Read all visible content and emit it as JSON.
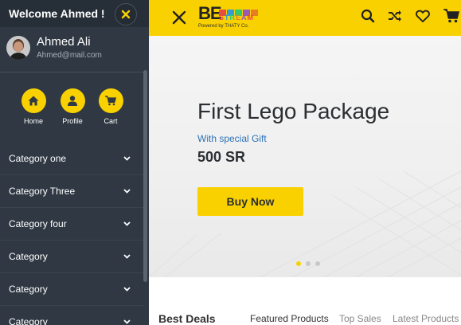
{
  "sidebar": {
    "title": "Welcome Ahmed !",
    "user": {
      "name": "Ahmed Ali",
      "email": "Ahmed@mail.com"
    },
    "quick_links": [
      {
        "label": "Home",
        "icon": "home-icon"
      },
      {
        "label": "Profile",
        "icon": "user-icon"
      },
      {
        "label": "Cart",
        "icon": "cart-icon"
      }
    ],
    "categories": [
      {
        "label": "Category one"
      },
      {
        "label": "Category Three"
      },
      {
        "label": "Category four"
      },
      {
        "label": "Category"
      },
      {
        "label": "Category"
      },
      {
        "label": "Category"
      }
    ]
  },
  "header": {
    "logo": {
      "main": "BE",
      "stream": "STREAM",
      "tagline": "Powered by THATY Co."
    },
    "icons": [
      "search-icon",
      "shuffle-icon",
      "heart-icon",
      "cart-icon"
    ]
  },
  "hero": {
    "title": "First Lego Package",
    "subtitle": "With special Gift",
    "price": "500 SR",
    "button": "Buy Now",
    "slides": 3,
    "active_slide": 1
  },
  "products": {
    "heading": "Best Deals",
    "tabs": [
      "Featured Products",
      "Top Sales",
      "Latest Products"
    ],
    "active_tab": 0
  },
  "colors": {
    "accent": "#f9d100",
    "sidebar": "#2f3843",
    "link": "#2c72b8"
  }
}
